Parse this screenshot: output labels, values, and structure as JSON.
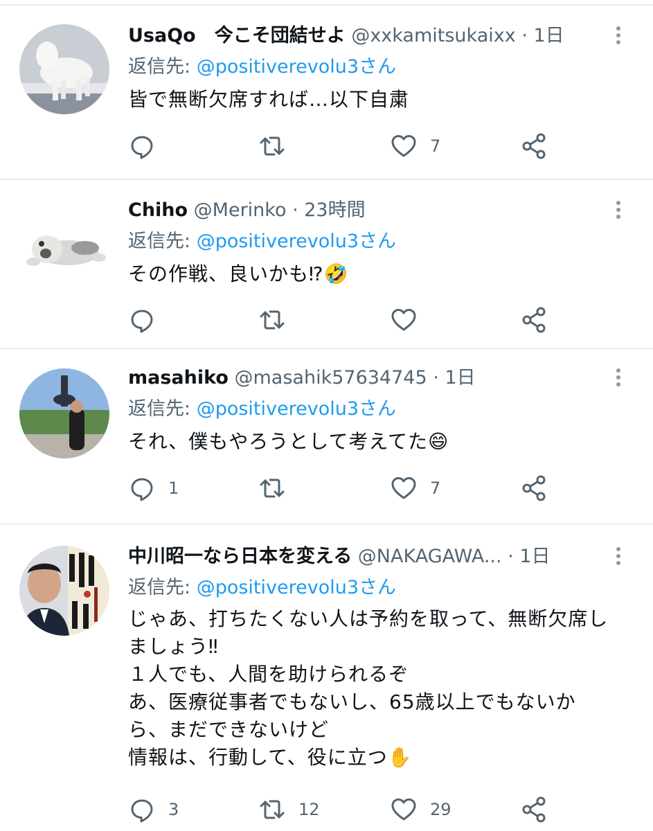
{
  "tweets": [
    {
      "name": "UsaQo　今こそ団結せよ",
      "handle": "@xxkamitsukaixx",
      "time": "· 1日",
      "reply_prefix": "返信先: ",
      "reply_mention": "@positiverevolu3さん",
      "body": [
        "皆で無断欠席すれば…以下自粛"
      ],
      "reply_count": "",
      "retweet_count": "",
      "like_count": "7",
      "avatar": "white-dog-photo"
    },
    {
      "name": "Chiho",
      "handle": "@Merinko",
      "time": "· 23時間",
      "reply_prefix": "返信先: ",
      "reply_mention": "@positiverevolu3さん",
      "body": [
        "その作戦、良いかも⁉🤣"
      ],
      "reply_count": "",
      "retweet_count": "",
      "like_count": "",
      "avatar": "plush-dog-photo"
    },
    {
      "name": "masahiko",
      "handle": "@masahik57634745",
      "time": "· 1日",
      "reply_prefix": "返信先: ",
      "reply_mention": "@positiverevolu3さん",
      "body": [
        "それ、僕もやろうとして考えてた😄"
      ],
      "reply_count": "1",
      "retweet_count": "",
      "like_count": "7",
      "avatar": "person-statue-photo"
    },
    {
      "name": "中川昭一なら日本を変える",
      "handle": "@NAKAGAWA...",
      "time": "· 1日",
      "reply_prefix": "返信先: ",
      "reply_mention": "@positiverevolu3さん",
      "body": [
        "じゃあ、打ちたくない人は予約を取って、無断欠席し",
        "ましょう‼",
        "１人でも、人間を助けられるぞ",
        "あ、医療従事者でもないし、65歳以上でもないか",
        "ら、まだできないけど",
        "情報は、行動して、役に立つ✋"
      ],
      "reply_count": "3",
      "retweet_count": "12",
      "like_count": "29",
      "avatar": "man-portrait-photo"
    }
  ],
  "icons": {
    "reply": "reply-icon",
    "retweet": "retweet-icon",
    "like": "heart-icon",
    "share": "share-icon",
    "more": "more-vertical-icon"
  },
  "colors": {
    "link": "#1d9bf0",
    "secondary": "#536471",
    "divider": "#e6ecf0"
  }
}
